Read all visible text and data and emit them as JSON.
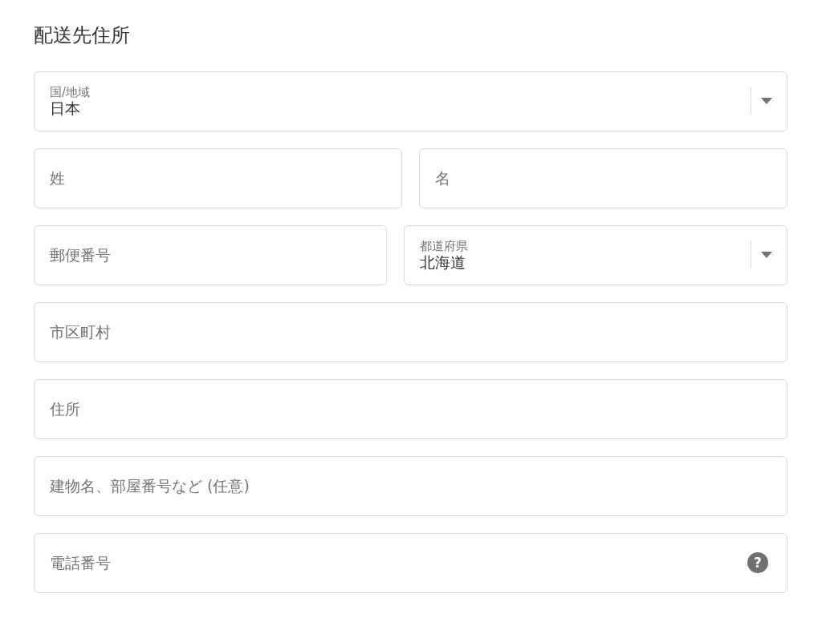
{
  "title": "配送先住所",
  "rows": [
    [
      {
        "kind": "select",
        "label": "国/地域",
        "value": "日本"
      }
    ],
    [
      {
        "kind": "text",
        "placeholder": "姓"
      },
      {
        "kind": "text",
        "placeholder": "名"
      }
    ],
    [
      {
        "kind": "text",
        "placeholder": "郵便番号"
      },
      {
        "kind": "select",
        "label": "都道府県",
        "value": "北海道"
      }
    ],
    [
      {
        "kind": "text",
        "placeholder": "市区町村"
      }
    ],
    [
      {
        "kind": "text",
        "placeholder": "住所"
      }
    ],
    [
      {
        "kind": "text",
        "placeholder": "建物名、部屋番号など (任意)"
      }
    ],
    [
      {
        "kind": "phone",
        "placeholder": "電話番号",
        "help_icon": "?"
      }
    ]
  ]
}
